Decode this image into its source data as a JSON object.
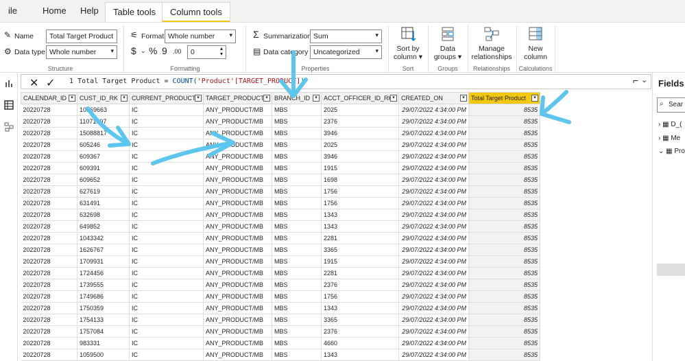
{
  "ribbon_tabs": [
    {
      "label": "ile"
    },
    {
      "label": "Home"
    },
    {
      "label": "Help"
    },
    {
      "label": "Table tools"
    },
    {
      "label": "Column tools"
    }
  ],
  "structure": {
    "name_label": "Name",
    "name_value": "Total Target Product",
    "datatype_label": "Data type",
    "datatype_value": "Whole number",
    "group_label": "Structure"
  },
  "formatting": {
    "format_label": "Format",
    "format_value": "Whole number",
    "decimal_value": "0",
    "currency_symbol": "$",
    "percent_symbol": "%",
    "comma_symbol": "9",
    "group_label": "Formatting"
  },
  "properties": {
    "summarization_label": "Summarization",
    "summarization_value": "Sum",
    "category_label": "Data category",
    "category_value": "Uncategorized",
    "group_label": "Properties"
  },
  "sort": {
    "button": "Sort by column",
    "group_label": "Sort"
  },
  "groups": {
    "button": "Data groups",
    "group_label": "Groups"
  },
  "relationships": {
    "button": "Manage relationships",
    "group_label": "Relationships"
  },
  "calculations": {
    "button": "New column",
    "group_label": "Calculations"
  },
  "formula_bar": {
    "line_no": "1",
    "prefix": "Total Target Product = ",
    "func": "COUNT(",
    "arg": "'Product'[TARGET_PRODUCT]",
    "suffix": ")"
  },
  "fields_pane": {
    "title": "Fields",
    "search_placeholder": "Sear",
    "items": [
      "D_(",
      "Me",
      "Pro"
    ]
  },
  "table": {
    "columns": [
      "CALENDAR_ID",
      "CUST_ID_RK",
      "CURRENT_PRODUCT",
      "TARGET_PRODUCT",
      "BRANCH_ID",
      "ACCT_OFFICER_ID_RK",
      "CREATED_ON",
      "Total Target Product"
    ],
    "rows": [
      [
        "20220728",
        "10869663",
        "IC",
        "ANY_PRODUCT/MB",
        "MBS",
        "2025",
        "29/07/2022 4:34:00 PM",
        "8535"
      ],
      [
        "20220728",
        "11071397",
        "IC",
        "ANY_PRODUCT/MB",
        "MBS",
        "2376",
        "29/07/2022 4:34:00 PM",
        "8535"
      ],
      [
        "20220728",
        "15088817",
        "IC",
        "ANY_PRODUCT/MB",
        "MBS",
        "3946",
        "29/07/2022 4:34:00 PM",
        "8535"
      ],
      [
        "20220728",
        "605246",
        "IC",
        "ANY_PRODUCT/MB",
        "MBS",
        "2025",
        "29/07/2022 4:34:00 PM",
        "8535"
      ],
      [
        "20220728",
        "609367",
        "IC",
        "ANY_PRODUCT/MB",
        "MBS",
        "3946",
        "29/07/2022 4:34:00 PM",
        "8535"
      ],
      [
        "20220728",
        "609391",
        "IC",
        "ANY_PRODUCT/MB",
        "MBS",
        "1915",
        "29/07/2022 4:34:00 PM",
        "8535"
      ],
      [
        "20220728",
        "609652",
        "IC",
        "ANY_PRODUCT/MB",
        "MBS",
        "1698",
        "29/07/2022 4:34:00 PM",
        "8535"
      ],
      [
        "20220728",
        "627619",
        "IC",
        "ANY_PRODUCT/MB",
        "MBS",
        "1756",
        "29/07/2022 4:34:00 PM",
        "8535"
      ],
      [
        "20220728",
        "631491",
        "IC",
        "ANY_PRODUCT/MB",
        "MBS",
        "1756",
        "29/07/2022 4:34:00 PM",
        "8535"
      ],
      [
        "20220728",
        "632698",
        "IC",
        "ANY_PRODUCT/MB",
        "MBS",
        "1343",
        "29/07/2022 4:34:00 PM",
        "8535"
      ],
      [
        "20220728",
        "649852",
        "IC",
        "ANY_PRODUCT/MB",
        "MBS",
        "1343",
        "29/07/2022 4:34:00 PM",
        "8535"
      ],
      [
        "20220728",
        "1043342",
        "IC",
        "ANY_PRODUCT/MB",
        "MBS",
        "2281",
        "29/07/2022 4:34:00 PM",
        "8535"
      ],
      [
        "20220728",
        "1626767",
        "IC",
        "ANY_PRODUCT/MB",
        "MBS",
        "3365",
        "29/07/2022 4:34:00 PM",
        "8535"
      ],
      [
        "20220728",
        "1709931",
        "IC",
        "ANY_PRODUCT/MB",
        "MBS",
        "1915",
        "29/07/2022 4:34:00 PM",
        "8535"
      ],
      [
        "20220728",
        "1724456",
        "IC",
        "ANY_PRODUCT/MB",
        "MBS",
        "2281",
        "29/07/2022 4:34:00 PM",
        "8535"
      ],
      [
        "20220728",
        "1739555",
        "IC",
        "ANY_PRODUCT/MB",
        "MBS",
        "2376",
        "29/07/2022 4:34:00 PM",
        "8535"
      ],
      [
        "20220728",
        "1749686",
        "IC",
        "ANY_PRODUCT/MB",
        "MBS",
        "1756",
        "29/07/2022 4:34:00 PM",
        "8535"
      ],
      [
        "20220728",
        "1750359",
        "IC",
        "ANY_PRODUCT/MB",
        "MBS",
        "1343",
        "29/07/2022 4:34:00 PM",
        "8535"
      ],
      [
        "20220728",
        "1754133",
        "IC",
        "ANY_PRODUCT/MB",
        "MBS",
        "3365",
        "29/07/2022 4:34:00 PM",
        "8535"
      ],
      [
        "20220728",
        "1757084",
        "IC",
        "ANY_PRODUCT/MB",
        "MBS",
        "2376",
        "29/07/2022 4:34:00 PM",
        "8535"
      ],
      [
        "20220728",
        "983331",
        "IC",
        "ANY_PRODUCT/MB",
        "MBS",
        "4660",
        "29/07/2022 4:34:00 PM",
        "8535"
      ],
      [
        "20220728",
        "1059500",
        "IC",
        "ANY_PRODUCT/MB",
        "MBS",
        "1343",
        "29/07/2022 4:34:00 PM",
        "8535"
      ]
    ]
  },
  "colors": {
    "accent": "#f2c811",
    "annotation_arrow": "#5ec6ee"
  }
}
